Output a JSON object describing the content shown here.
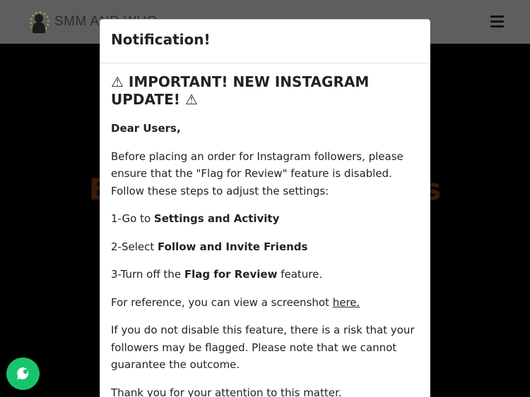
{
  "header": {
    "logo_text": "SMM AND WHO",
    "menu_icon": "hamburger-icon"
  },
  "hero": {
    "title": "Buy Instagram Views"
  },
  "chat_widget": {
    "icon": "chat-bubble-icon",
    "color": "#18c46b"
  },
  "modal": {
    "title": "Notification!",
    "heading_warning_icon": "⚠",
    "heading_text": "IMPORTANT! NEW INSTAGRAM UPDATE!",
    "heading_warning_icon_end": "⚠",
    "greeting": "Dear Users,",
    "intro": "Before placing an order for Instagram followers, please ensure that the \"Flag for Review\" feature is disabled. Follow these steps to adjust the settings:",
    "steps": [
      {
        "prefix": "1-Go to ",
        "bold": "Settings and Activity",
        "suffix": ""
      },
      {
        "prefix": "2-Select ",
        "bold": "Follow and Invite Friends",
        "suffix": ""
      },
      {
        "prefix": "3-Turn off the ",
        "bold": "Flag for Review",
        "suffix": " feature."
      }
    ],
    "reference_text": "For reference, you can view a screenshot ",
    "reference_link": "here.",
    "risk_text": "If you do not disable this feature, there is a risk that your followers may be flagged. Please note that we cannot guarantee the outcome.",
    "thanks_text": "Thank you for your attention to this matter."
  }
}
